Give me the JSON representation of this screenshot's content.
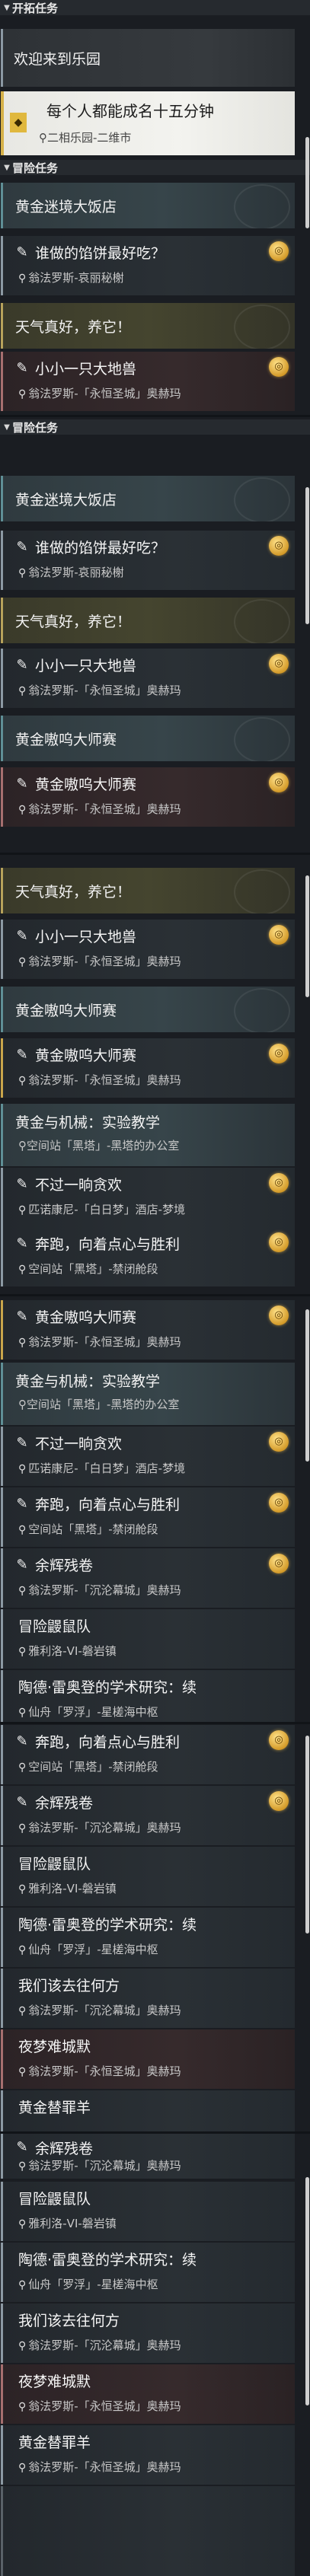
{
  "sections": {
    "trailblaze": "开拓任务",
    "adventure": "冒险任务"
  },
  "welcome_text": "欢迎来到乐园",
  "selected_quest": {
    "title": "每个人都能成名十五分钟",
    "location": "二相乐园-二维市"
  },
  "titles": {
    "golden_restaurant": "黄金迷境大饭店",
    "weather": "天气真好，养它！",
    "golden_shout_master": "黄金嗷呜大师赛",
    "gold_machine": "黄金与机械：实验教学",
    "nightmare": "夜梦难城默",
    "golden_scapegoat": "黄金替罪羊"
  },
  "quests": {
    "dumpling": {
      "title": "谁做的馅饼最好吃？",
      "location": "翁法罗斯-哀丽秘榭"
    },
    "little_beast": {
      "title": "小小一只大地兽",
      "location": "翁法罗斯-「永恒圣城」奥赫玛"
    },
    "shout_master": {
      "title": "黄金嗷呜大师赛",
      "location": "翁法罗斯-「永恒圣城」奥赫玛"
    },
    "gold_machine": {
      "title": "黄金与机械：实验教学",
      "location": "空间站「黑塔」-黑塔的办公室"
    },
    "not_a_song": {
      "title": "不过一晌贪欢",
      "location": "匹诺康尼-「白日梦」酒店-梦境"
    },
    "run": {
      "title": "奔跑，向着点心与胜利",
      "location": "空间站「黑塔」-禁闭舱段"
    },
    "ember": {
      "title": "余辉残卷",
      "location": "翁法罗斯-「沉沦幕城」奥赫玛"
    },
    "adventure_mouse": {
      "title": "冒险鼹鼠队",
      "location": "雅利洛-VI-磐岩镇"
    },
    "tao_research": {
      "title": "陶德·雷奥登的学术研究：续",
      "location": "仙舟「罗浮」-星槎海中枢"
    },
    "where": {
      "title": "我们该去往何方",
      "location": "翁法罗斯-「沉沦幕城」奥赫玛"
    },
    "nightmare": {
      "title": "夜梦难城默",
      "location": "翁法罗斯-「永恒圣城」奥赫玛"
    },
    "scapegoat": {
      "title": "黄金替罪羊",
      "location": "翁法罗斯-「永恒圣城」奥赫玛"
    }
  },
  "icons": {
    "quest": "quest-scroll-icon",
    "location": "location-pin-icon",
    "reward": "reward-coin-icon"
  },
  "colors": {
    "accent_gold": "#d6b24a",
    "selected_bg": "#f0f0ec"
  }
}
